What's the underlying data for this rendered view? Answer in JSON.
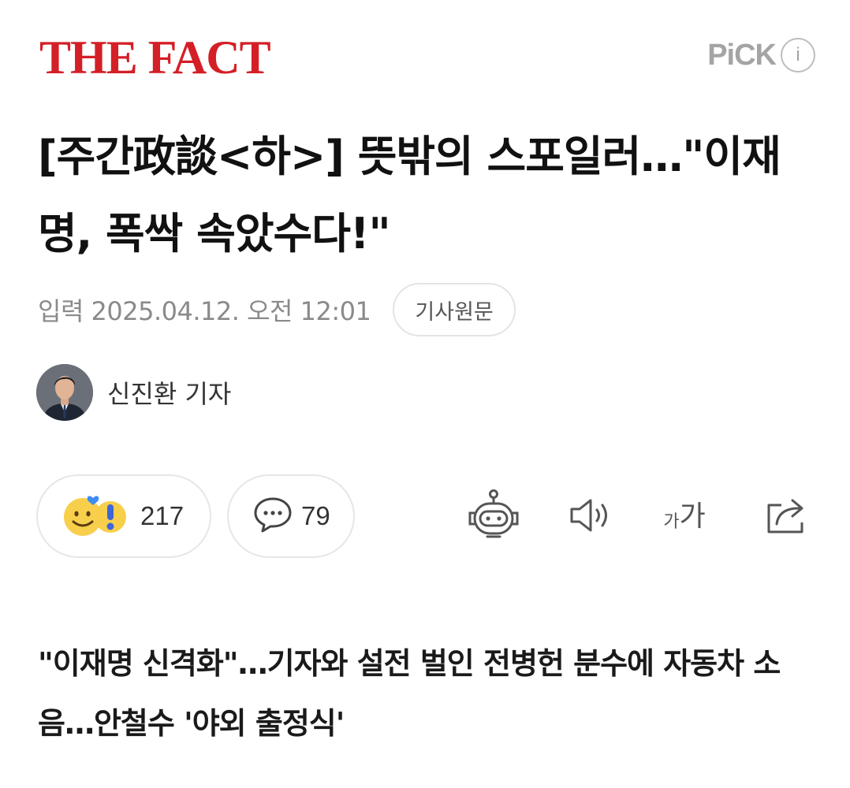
{
  "header": {
    "logo_text": "THE FACT",
    "pick_label": "PiCK",
    "info_label": "i",
    "logo_color": "#d41f26"
  },
  "article": {
    "title": "[주간政談<하>] 뜻밖의 스포일러…\"이재명, 폭싹 속았수다!\"",
    "date": "입력 2025.04.12. 오전 12:01",
    "original_button": "기사원문",
    "author": "신진환 기자",
    "subtitle": "\"이재명 신격화\"…기자와 설전 벌인 전병헌 분수에 자동차 소음…안철수 '야외 출정식'"
  },
  "toolbar": {
    "reaction_count": "217",
    "comment_count": "79",
    "font_size_label_small": "가",
    "font_size_label_large": "가",
    "icons": [
      "reaction-emoji-icon",
      "speech-bubble-icon",
      "robot-summary-icon",
      "speaker-icon",
      "font-size-icon",
      "share-icon"
    ]
  }
}
